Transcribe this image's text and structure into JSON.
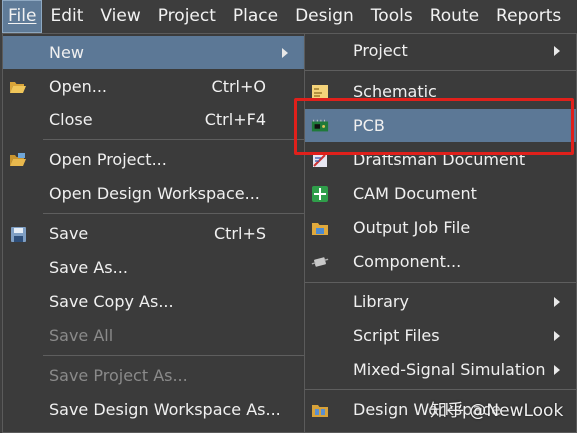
{
  "menubar": {
    "file": "File",
    "edit": "Edit",
    "view": "View",
    "project": "Project",
    "place": "Place",
    "design": "Design",
    "tools": "Tools",
    "route": "Route",
    "reports": "Reports"
  },
  "file_menu": {
    "new": "New",
    "open": "Open...",
    "open_shortcut": "Ctrl+O",
    "close": "Close",
    "close_shortcut": "Ctrl+F4",
    "open_project": "Open Project...",
    "open_design_workspace": "Open Design Workspace...",
    "save": "Save",
    "save_shortcut": "Ctrl+S",
    "save_as": "Save As...",
    "save_copy_as": "Save Copy As...",
    "save_all": "Save All",
    "save_project_as": "Save Project As...",
    "save_design_workspace_as": "Save Design Workspace As..."
  },
  "new_menu": {
    "project": "Project",
    "schematic": "Schematic",
    "pcb": "PCB",
    "draftsman": "Draftsman Document",
    "cam": "CAM Document",
    "output_job": "Output Job File",
    "component": "Component...",
    "library": "Library",
    "script_files": "Script Files",
    "mixed_signal": "Mixed-Signal Simulation",
    "design_workspace": "Design Workspace"
  },
  "watermark": "知乎 @NewLook",
  "colors": {
    "highlight": "#5c7896",
    "annotation_box": "#e0201b",
    "menu_bg": "#3b3b3b"
  }
}
